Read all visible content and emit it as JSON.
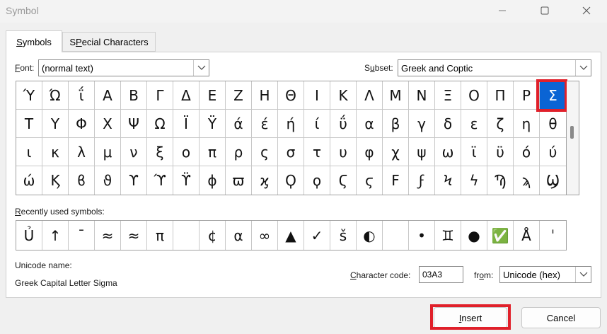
{
  "window": {
    "title": "Symbol"
  },
  "tabs": [
    {
      "label": "Symbols",
      "mnemonic": "S",
      "rest": "ymbols"
    },
    {
      "label": "Special Characters",
      "mnemonic": "P",
      "pre": "S",
      "rest": "ecial Characters"
    }
  ],
  "font": {
    "label_mn": "F",
    "label_rest": "ont:",
    "value": "(normal text)"
  },
  "subset": {
    "label_pre": "S",
    "label_mn": "u",
    "label_rest": "bset:",
    "value": "Greek and Coptic"
  },
  "symbols": [
    [
      "Ύ",
      "Ώ",
      "ΐ",
      "Α",
      "Β",
      "Γ",
      "Δ",
      "Ε",
      "Ζ",
      "Η",
      "Θ",
      "Ι",
      "Κ",
      "Λ",
      "Μ",
      "Ν",
      "Ξ",
      "Ο",
      "Π",
      "Ρ",
      "Σ"
    ],
    [
      "Τ",
      "Υ",
      "Φ",
      "Χ",
      "Ψ",
      "Ω",
      "Ϊ",
      "Ϋ",
      "ά",
      "έ",
      "ή",
      "ί",
      "ΰ",
      "α",
      "β",
      "γ",
      "δ",
      "ε",
      "ζ",
      "η",
      "θ"
    ],
    [
      "ι",
      "κ",
      "λ",
      "μ",
      "ν",
      "ξ",
      "ο",
      "π",
      "ρ",
      "ς",
      "σ",
      "τ",
      "υ",
      "φ",
      "χ",
      "ψ",
      "ω",
      "ϊ",
      "ϋ",
      "ό",
      "ύ"
    ],
    [
      "ώ",
      "Ϗ",
      "ϐ",
      "ϑ",
      "ϒ",
      "ϓ",
      "ϔ",
      "ϕ",
      "ϖ",
      "ϗ",
      "Ϙ",
      "ϙ",
      "Ϛ",
      "ϛ",
      "Ϝ",
      "ϝ",
      "Ϟ",
      "ϟ",
      "Ϡ",
      "ϡ",
      "Ϣ"
    ]
  ],
  "selected_symbol": {
    "row": 0,
    "col": 20
  },
  "recent": {
    "label_mn": "R",
    "label_rest": "ecently used symbols:",
    "symbols": [
      "Ủ",
      "↑",
      "¯",
      "≈",
      "≈",
      "π",
      "",
      "¢",
      "α",
      "∞",
      "▲",
      "✓",
      "š",
      "◐",
      "",
      "•",
      "♊",
      "●",
      "✅",
      "Å",
      "ˈ"
    ]
  },
  "unicode_name": {
    "label": "Unicode name:",
    "value": "Greek Capital Letter Sigma"
  },
  "char_code": {
    "label_mn": "C",
    "label_rest": "haracter code:",
    "value": "03A3"
  },
  "from": {
    "label_pre": "fr",
    "label_mn": "o",
    "label_rest": "m:",
    "value": "Unicode (hex)"
  },
  "buttons": {
    "insert_mn": "I",
    "insert_rest": "nsert",
    "cancel": "Cancel"
  },
  "colors": {
    "selection": "#0a64d4",
    "highlight": "#e0202a"
  },
  "icons": {
    "minimize": "minimize-icon",
    "maximize": "maximize-icon",
    "close": "close-icon",
    "dropdown": "chevron-down-icon"
  }
}
